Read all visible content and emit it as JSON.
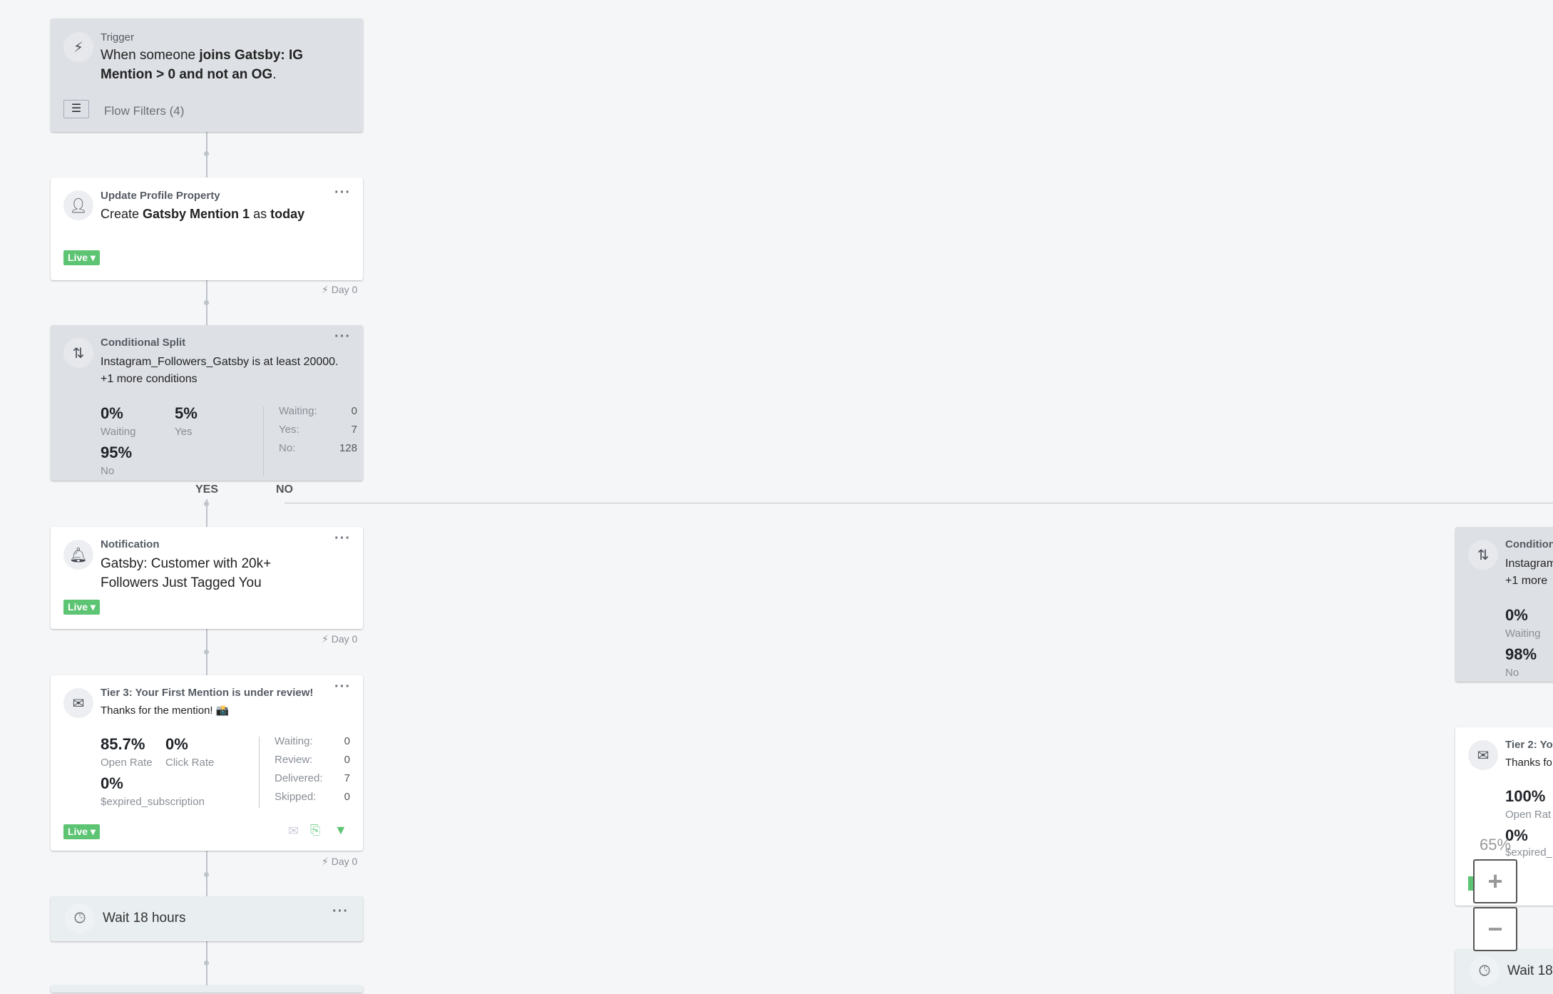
{
  "trigger": {
    "label": "Trigger",
    "text_pre": "When someone ",
    "text_bold": "joins Gatsby: IG Mention > 0 and not an OG",
    "text_post": ".",
    "filters": "Flow Filters (4)"
  },
  "update": {
    "label": "Update Profile Property",
    "t1": "Create ",
    "b1": "Gatsby Mention 1",
    "t2": " as ",
    "b2": "today",
    "status": "Live",
    "day": "Day 0"
  },
  "split": {
    "label": "Conditional Split",
    "condition": "Instagram_Followers_Gatsby is at least 20000.",
    "more": "+1 more conditions",
    "waiting_pct": "0%",
    "waiting_label": "Waiting",
    "yes_pct": "5%",
    "yes_label": "Yes",
    "no_pct": "95%",
    "no_label": "No",
    "stats": [
      {
        "k": "Waiting:",
        "v": "0"
      },
      {
        "k": "Yes:",
        "v": "7"
      },
      {
        "k": "No:",
        "v": "128"
      }
    ],
    "yes_branch": "YES",
    "no_branch": "NO"
  },
  "notification": {
    "label": "Notification",
    "text": "Gatsby: Customer with 20k+ Followers Just Tagged You",
    "status": "Live",
    "day": "Day 0"
  },
  "email": {
    "label": "Tier 3: Your First Mention is under review!",
    "subject": "Thanks for the mention! 📸",
    "open_rate": "85.7%",
    "open_label": "Open Rate",
    "click_rate": "0%",
    "click_label": "Click Rate",
    "conv": "0%",
    "conv_label": "$expired_subscription",
    "stats": [
      {
        "k": "Waiting:",
        "v": "0"
      },
      {
        "k": "Review:",
        "v": "0"
      },
      {
        "k": "Delivered:",
        "v": "7"
      },
      {
        "k": "Skipped:",
        "v": "0"
      }
    ],
    "status": "Live",
    "day": "Day 0"
  },
  "wait": {
    "text": "Wait 18 hours"
  },
  "right": {
    "split_label": "Condition",
    "split_text": "Instagram",
    "split_more": "+1 more",
    "waiting_pct": "0%",
    "waiting_label": "Waiting",
    "no_pct": "98%",
    "no_label": "No",
    "email_label": "Tier 2: Yo",
    "email_subject": "Thanks fo",
    "open_rate": "100%",
    "open_label": "Open Rat",
    "conv": "0%",
    "conv_label": "$expired_",
    "wait": "Wait 18"
  },
  "zoom": {
    "level": "65%",
    "in": "+",
    "out": "−"
  }
}
